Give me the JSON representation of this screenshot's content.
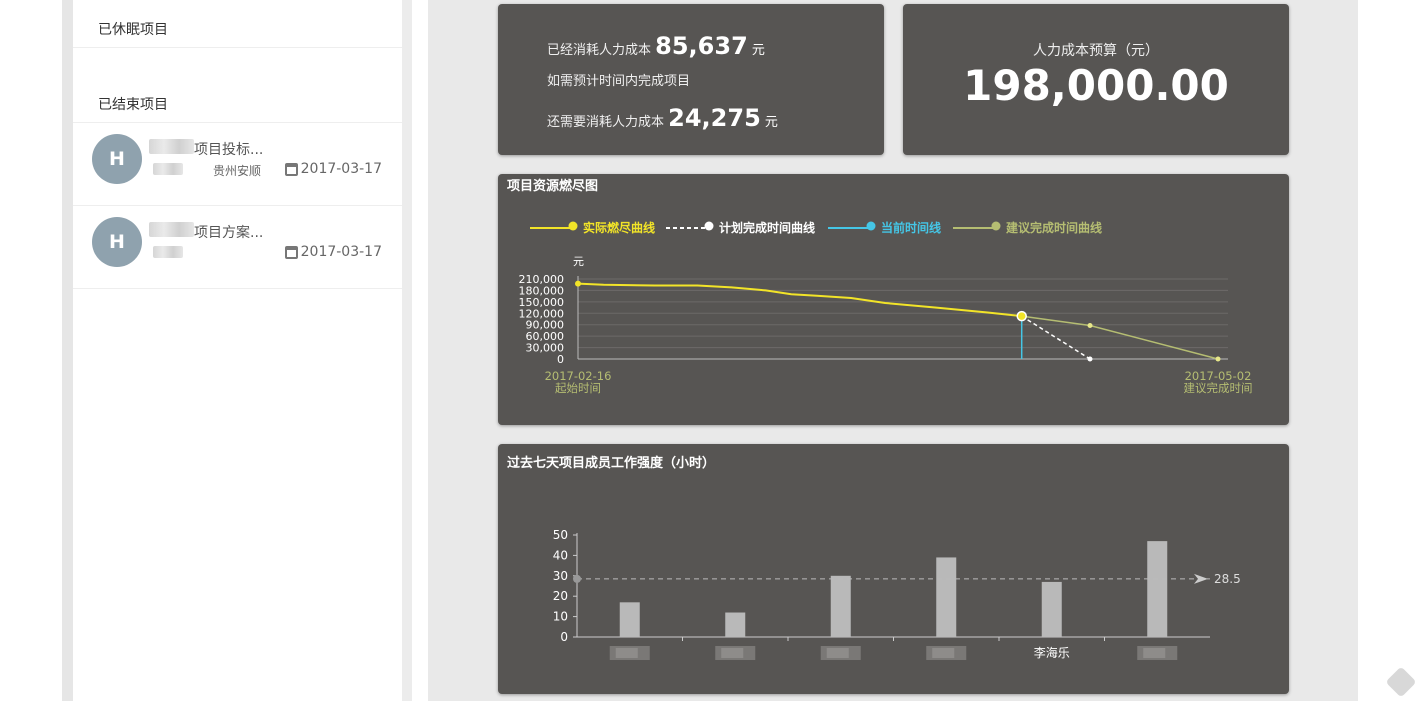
{
  "sidebar": {
    "dormant_title": "已休眠项目",
    "finished_title": "已结束项目",
    "projects": [
      {
        "initial": "H",
        "name": "项目投标...",
        "location": "贵州安顺",
        "date": "2017-03-17"
      },
      {
        "initial": "H",
        "name": "项目方案...",
        "location": "",
        "date": "2017-03-17"
      }
    ]
  },
  "cost_card": {
    "consumed_label": "已经消耗人力成本",
    "consumed_value": "85,637",
    "unit": "元",
    "plan_note": "如需预计时间内完成项目",
    "remaining_label": "还需要消耗人力成本",
    "remaining_value": "24,275"
  },
  "budget_card": {
    "label": "人力成本预算（元）",
    "value": "198,000.00"
  },
  "burndown": {
    "title": "项目资源燃尽图",
    "legend": [
      {
        "label": "实际燃尽曲线",
        "color": "#f2e428",
        "dashed": false
      },
      {
        "label": "计划完成时间曲线",
        "color": "#ffffff",
        "dashed": true
      },
      {
        "label": "当前时间线",
        "color": "#45c6e6",
        "dashed": false
      },
      {
        "label": "建议完成时间曲线",
        "color": "#b5bd72",
        "dashed": false
      }
    ],
    "y_unit": "元",
    "start_date": "2017-02-16",
    "start_label": "起始时间",
    "end_date": "2017-05-02",
    "end_label": "建议完成时间"
  },
  "chart_data": [
    {
      "type": "line",
      "title": "项目资源燃尽图",
      "ylabel": "元",
      "ylim": [
        0,
        210000
      ],
      "yticks": [
        0,
        30000,
        60000,
        90000,
        120000,
        150000,
        180000,
        210000
      ],
      "ytick_labels": [
        "0",
        "30,000",
        "60,000",
        "90,000",
        "120,000",
        "150,000",
        "180,000",
        "210,000"
      ],
      "x_range": [
        "2017-02-16",
        "2017-05-02"
      ],
      "grid": true,
      "legend_position": "top",
      "series": [
        {
          "name": "实际燃尽曲线",
          "color": "#f2e428",
          "x": [
            "2017-02-16",
            "2017-02-19",
            "2017-02-25",
            "2017-03-02",
            "2017-03-06",
            "2017-03-10",
            "2017-03-13",
            "2017-03-16",
            "2017-03-20",
            "2017-03-24",
            "2017-03-30",
            "2017-04-05",
            "2017-04-09"
          ],
          "y": [
            198000,
            195000,
            193000,
            193000,
            188000,
            180000,
            170000,
            166000,
            160000,
            147000,
            135000,
            122000,
            112500
          ]
        },
        {
          "name": "计划完成时间曲线",
          "color": "#ffffff",
          "dashed": true,
          "x": [
            "2017-04-09",
            "2017-04-17"
          ],
          "y": [
            112500,
            0
          ]
        },
        {
          "name": "当前时间线",
          "color": "#45c6e6",
          "x": [
            "2017-04-09",
            "2017-04-09"
          ],
          "y": [
            0,
            112500
          ]
        },
        {
          "name": "建议完成时间曲线",
          "color": "#b5bd72",
          "x": [
            "2017-04-09",
            "2017-04-17",
            "2017-05-02"
          ],
          "y": [
            112500,
            88000,
            0
          ]
        }
      ]
    },
    {
      "type": "bar",
      "title": "过去七天项目成员工作强度（小时）",
      "ylim": [
        0,
        50
      ],
      "yticks": [
        0,
        10,
        20,
        30,
        40,
        50
      ],
      "categories": [
        "",
        "",
        "",
        "",
        "李海乐",
        ""
      ],
      "values": [
        17,
        12,
        30,
        39,
        27,
        47
      ],
      "average_line": {
        "value": 28.5,
        "label": "28.5"
      },
      "bar_color": "#b9b9b9"
    }
  ]
}
